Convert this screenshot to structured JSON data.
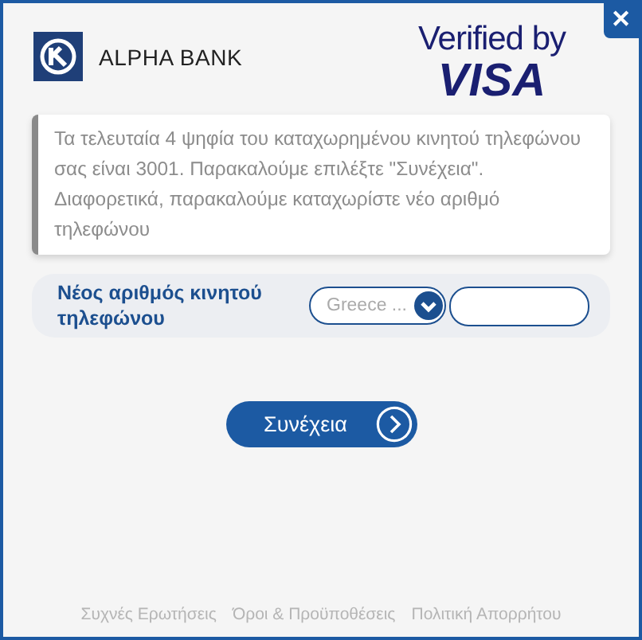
{
  "header": {
    "bank_name": "ALPHA BANK",
    "verified_by": "Verified by",
    "visa": "VISA",
    "close": "✕"
  },
  "message": "Τα τελευταία 4 ψηφία του καταχωρημένου κινητού τηλεφώνου σας είναι 3001. Παρακαλούμε επιλέξτε \"Συνέχεια\". Διαφορετικά, παρακαλούμε καταχωρίστε νέο αριθμό τηλεφώνου",
  "phone": {
    "label": "Νέος αριθμός κινητού τηλεφώνου",
    "country_placeholder": "Greece ..."
  },
  "continue_button": "Συνέχεια",
  "footer_links": [
    "Συχνές Ερωτήσεις",
    "Όροι & Προϋποθέσεις",
    "Πολιτική Απορρήτου"
  ]
}
